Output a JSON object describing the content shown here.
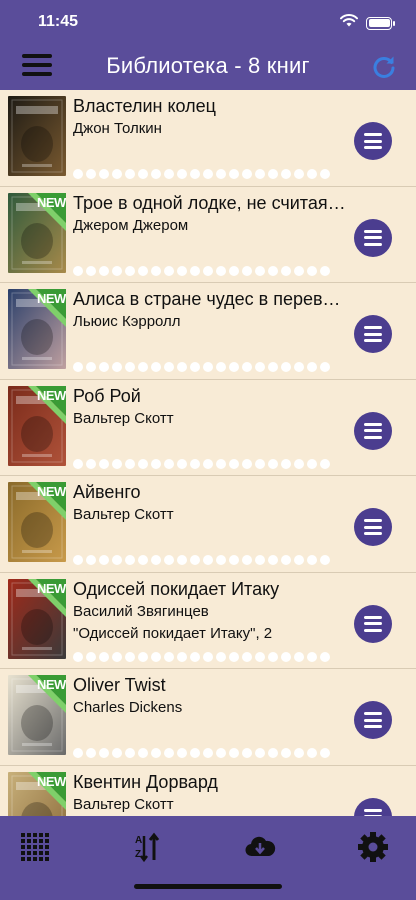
{
  "status_bar": {
    "time": "11:45",
    "icons": [
      "wifi-icon",
      "battery-icon"
    ]
  },
  "header": {
    "title": "Библиотека - 8 книг",
    "left_icon": "hamburger-menu-icon",
    "right_icon": "refresh-icon"
  },
  "colors": {
    "bar": "#5a4d9a",
    "list_bg": "#f8ebd6",
    "row_button": "#4b3d8f",
    "new_badge": "#3a9b35"
  },
  "books": [
    {
      "title": "Властелин колец",
      "author": "Джон Толкин",
      "series": "",
      "is_new": false,
      "cover_colors": [
        "#1d1a14",
        "#7a5a30"
      ]
    },
    {
      "title": "Трое в одной лодке, не считая собаки",
      "author": "Джером Джером",
      "series": "",
      "is_new": true,
      "cover_colors": [
        "#2f5a3c",
        "#a88a4a"
      ]
    },
    {
      "title": "Алиса в стране чудес в переводе",
      "author": "Льюис Кэрролл",
      "series": "",
      "is_new": true,
      "cover_colors": [
        "#2a3f6a",
        "#c0a0a0"
      ]
    },
    {
      "title": "Роб Рой",
      "author": "Вальтер Скотт",
      "series": "",
      "is_new": true,
      "cover_colors": [
        "#7a2a1a",
        "#b0533a"
      ]
    },
    {
      "title": "Айвенго",
      "author": "Вальтер Скотт",
      "series": "",
      "is_new": true,
      "cover_colors": [
        "#8a6a2a",
        "#c89a4a"
      ]
    },
    {
      "title": "Одиссей покидает Итаку",
      "author": "Василий Звягинцев",
      "series": "\"Одиссей покидает Итаку\", 2",
      "is_new": true,
      "cover_colors": [
        "#a02a1a",
        "#3a3a3a"
      ]
    },
    {
      "title": "Oliver Twist",
      "author": "Charles Dickens",
      "series": "",
      "is_new": true,
      "cover_colors": [
        "#e8e2d0",
        "#6a6a6a"
      ]
    },
    {
      "title": "Квентин Дорвард",
      "author": "Вальтер Скотт",
      "series": "",
      "is_new": true,
      "cover_colors": [
        "#c8b07a",
        "#8a6a3a"
      ]
    }
  ],
  "new_badge_text": "NEW",
  "tab_bar": {
    "icons": [
      "grid-view-icon",
      "sort-az-icon",
      "cloud-download-icon",
      "gear-icon"
    ]
  }
}
